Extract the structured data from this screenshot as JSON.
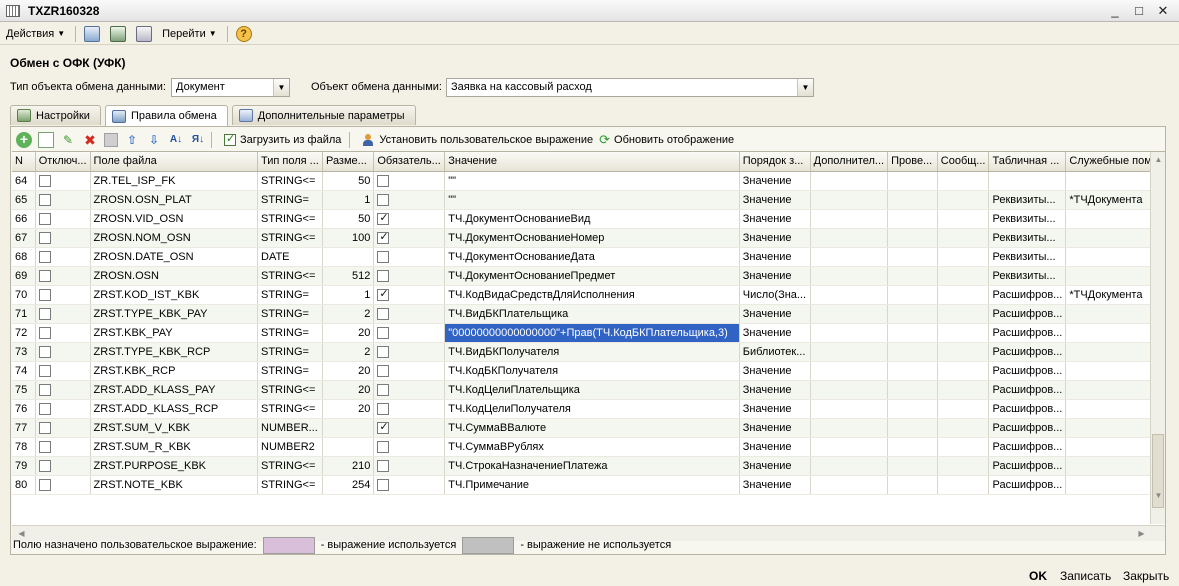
{
  "window": {
    "title": "TXZR160328",
    "minimize": "_",
    "maximize": "□",
    "close": "✕"
  },
  "toolbar": {
    "actions": "Действия",
    "goto": "Перейти",
    "help": "?"
  },
  "form": {
    "title": "Обмен с ОФК (УФК)",
    "object_type_label": "Тип объекта обмена данными:",
    "object_type_value": "Документ",
    "object_label": "Объект обмена данными:",
    "object_value": "Заявка на кассовый расход"
  },
  "tabs": [
    {
      "label": "Настройки"
    },
    {
      "label": "Правила обмена"
    },
    {
      "label": "Дополнительные параметры"
    }
  ],
  "panel_toolbar": {
    "load_file": "Загрузить из файла",
    "set_expression": "Установить пользовательское выражение",
    "refresh": "Обновить отображение"
  },
  "grid": {
    "columns": [
      "N",
      "Отключ...",
      "Поле файла",
      "Тип поля ...",
      "Разме...",
      "Обязатель...",
      "Значение",
      "Порядок з...",
      "Дополнител...",
      "Прове...",
      "Сообщ...",
      "Табличная ...",
      "Служебные пом..."
    ],
    "rows": [
      {
        "n": "64",
        "off": false,
        "field": "ZR.TEL_ISP_FK",
        "type": "STRING<=",
        "size": "50",
        "req": false,
        "value": "\"\"",
        "order": "Значение",
        "add": "",
        "check": "",
        "msg": "",
        "table": "",
        "service": ""
      },
      {
        "n": "65",
        "off": false,
        "field": "ZROSN.OSN_PLAT",
        "type": "STRING=",
        "size": "1",
        "req": false,
        "value": "\"\"",
        "order": "Значение",
        "add": "",
        "check": "",
        "msg": "",
        "table": "Реквизиты...",
        "service": "*ТЧДокумента"
      },
      {
        "n": "66",
        "off": false,
        "field": "ZROSN.VID_OSN",
        "type": "STRING<=",
        "size": "50",
        "req": true,
        "value": "ТЧ.ДокументОснованиеВид",
        "order": "Значение",
        "add": "",
        "check": "",
        "msg": "",
        "table": "Реквизиты...",
        "service": ""
      },
      {
        "n": "67",
        "off": false,
        "field": "ZROSN.NOM_OSN",
        "type": "STRING<=",
        "size": "100",
        "req": true,
        "value": "ТЧ.ДокументОснованиеНомер",
        "order": "Значение",
        "add": "",
        "check": "",
        "msg": "",
        "table": "Реквизиты...",
        "service": ""
      },
      {
        "n": "68",
        "off": false,
        "field": "ZROSN.DATE_OSN",
        "type": "DATE",
        "size": "",
        "req": false,
        "value": "ТЧ.ДокументОснованиеДата",
        "order": "Значение",
        "add": "",
        "check": "",
        "msg": "",
        "table": "Реквизиты...",
        "service": ""
      },
      {
        "n": "69",
        "off": false,
        "field": "ZROSN.OSN",
        "type": "STRING<=",
        "size": "512",
        "req": false,
        "value": "ТЧ.ДокументОснованиеПредмет",
        "order": "Значение",
        "add": "",
        "check": "",
        "msg": "",
        "table": "Реквизиты...",
        "service": ""
      },
      {
        "n": "70",
        "off": false,
        "field": "ZRST.KOD_IST_KBK",
        "type": "STRING=",
        "size": "1",
        "req": true,
        "value": "ТЧ.КодВидаСредствДляИсполнения",
        "order": "Число(Зна...",
        "add": "",
        "check": "",
        "msg": "",
        "table": "Расшифров...",
        "service": "*ТЧДокумента"
      },
      {
        "n": "71",
        "off": false,
        "field": "ZRST.TYPE_KBK_PAY",
        "type": "STRING=",
        "size": "2",
        "req": false,
        "value": "ТЧ.ВидБКПлательщика",
        "order": "Значение",
        "add": "",
        "check": "",
        "msg": "",
        "table": "Расшифров...",
        "service": ""
      },
      {
        "n": "72",
        "off": false,
        "field": "ZRST.KBK_PAY",
        "type": "STRING=",
        "size": "20",
        "req": false,
        "value": "\"00000000000000000\"+Прав(ТЧ.КодБКПлательщика,3)",
        "order": "Значение",
        "add": "",
        "check": "",
        "msg": "",
        "table": "Расшифров...",
        "service": ""
      },
      {
        "n": "73",
        "off": false,
        "field": "ZRST.TYPE_KBK_RCP",
        "type": "STRING=",
        "size": "2",
        "req": false,
        "value": "ТЧ.ВидБКПолучателя",
        "order": "Библиотек...",
        "add": "",
        "check": "",
        "msg": "",
        "table": "Расшифров...",
        "service": ""
      },
      {
        "n": "74",
        "off": false,
        "field": "ZRST.KBK_RCP",
        "type": "STRING=",
        "size": "20",
        "req": false,
        "value": "ТЧ.КодБКПолучателя",
        "order": "Значение",
        "add": "",
        "check": "",
        "msg": "",
        "table": "Расшифров...",
        "service": ""
      },
      {
        "n": "75",
        "off": false,
        "field": "ZRST.ADD_KLASS_PAY",
        "type": "STRING<=",
        "size": "20",
        "req": false,
        "value": "ТЧ.КодЦелиПлательщика",
        "order": "Значение",
        "add": "",
        "check": "",
        "msg": "",
        "table": "Расшифров...",
        "service": ""
      },
      {
        "n": "76",
        "off": false,
        "field": "ZRST.ADD_KLASS_RCP",
        "type": "STRING<=",
        "size": "20",
        "req": false,
        "value": "ТЧ.КодЦелиПолучателя",
        "order": "Значение",
        "add": "",
        "check": "",
        "msg": "",
        "table": "Расшифров...",
        "service": ""
      },
      {
        "n": "77",
        "off": false,
        "field": "ZRST.SUM_V_KBK",
        "type": "NUMBER...",
        "size": "",
        "req": true,
        "value": "ТЧ.СуммаВВалюте",
        "order": "Значение",
        "add": "",
        "check": "",
        "msg": "",
        "table": "Расшифров...",
        "service": ""
      },
      {
        "n": "78",
        "off": false,
        "field": "ZRST.SUM_R_KBK",
        "type": "NUMBER2",
        "size": "",
        "req": false,
        "value": "ТЧ.СуммаВРублях",
        "order": "Значение",
        "add": "",
        "check": "",
        "msg": "",
        "table": "Расшифров...",
        "service": ""
      },
      {
        "n": "79",
        "off": false,
        "field": "ZRST.PURPOSE_KBK",
        "type": "STRING<=",
        "size": "210",
        "req": false,
        "value": "ТЧ.СтрокаНазначениеПлатежа",
        "order": "Значение",
        "add": "",
        "check": "",
        "msg": "",
        "table": "Расшифров...",
        "service": ""
      },
      {
        "n": "80",
        "off": false,
        "field": "ZRST.NOTE_KBK",
        "type": "STRING<=",
        "size": "254",
        "req": false,
        "value": "ТЧ.Примечание",
        "order": "Значение",
        "add": "",
        "check": "",
        "msg": "",
        "table": "Расшифров...",
        "service": ""
      }
    ]
  },
  "legend": {
    "text1": "Полю назначено пользовательское выражение:",
    "text2": "- выражение используется",
    "text3": "- выражение не используется",
    "color_used": "#d9bfd9",
    "color_unused": "#c0c0c0"
  },
  "bottom": {
    "ok": "OK",
    "save": "Записать",
    "close": "Закрыть"
  },
  "colors": {
    "selection": "#3163c4",
    "row_alt": "#f4f7ef"
  }
}
